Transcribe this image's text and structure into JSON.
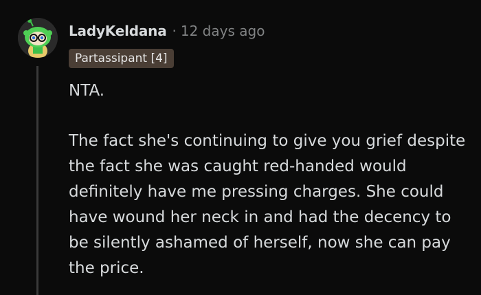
{
  "comment": {
    "author": "LadyKeldana",
    "separator": "·",
    "age": "12 days ago",
    "flair": "Partassipant [4]",
    "avatar_icon": "snoo-avatar-icon",
    "paragraphs": [
      "NTA.",
      "The fact she's continuing to give you grief despite the fact she was caught red-handed would definitely have me pressing charges. She could have wound her neck in and had the decency to be silently ashamed of herself, now she can pay the price."
    ]
  },
  "colors": {
    "background": "#0b0b0b",
    "text": "#d7dadc",
    "meta": "#818384",
    "flair_bg": "#4a3e35",
    "avatar_green": "#3ec04a"
  }
}
